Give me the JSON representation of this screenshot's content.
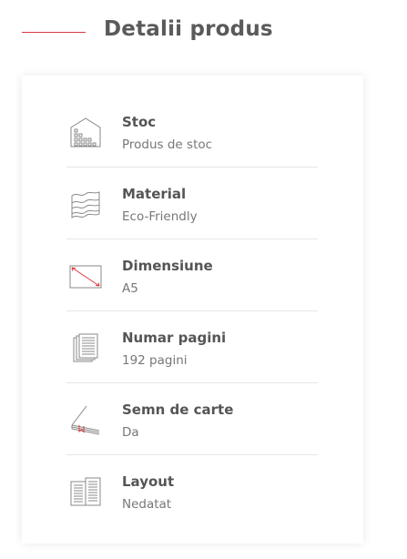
{
  "header": {
    "title": "Detalii produs"
  },
  "details": [
    {
      "label": "Stoc",
      "value": "Produs de stoc",
      "icon": "building-icon"
    },
    {
      "label": "Material",
      "value": "Eco-Friendly",
      "icon": "paper-stack-icon"
    },
    {
      "label": "Dimensiune",
      "value": "A5",
      "icon": "page-size-icon"
    },
    {
      "label": "Numar pagini",
      "value": "192 pagini",
      "icon": "pages-icon"
    },
    {
      "label": "Semn de carte",
      "value": "Da",
      "icon": "bookmark-icon"
    },
    {
      "label": "Layout",
      "value": "Nedatat",
      "icon": "layout-icon"
    }
  ],
  "colors": {
    "accent": "#d9383d",
    "text_dark": "#555555",
    "text_muted": "#777777",
    "separator": "#e6e6e6"
  }
}
